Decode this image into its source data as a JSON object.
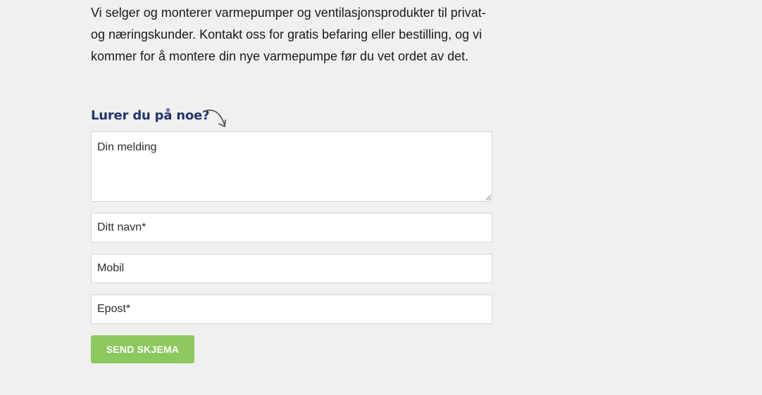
{
  "intro": {
    "text": "Vi selger og monterer varmepumper og ventilasjonsprodukter til privat- og næringskunder. Kontakt oss for gratis befaring eller bestilling, og vi kommer for å montere din nye varmepumpe før du vet ordet av det."
  },
  "form": {
    "heading": "Lurer du på noe?",
    "heading_icon": "curved-arrow-down-right-icon",
    "message_placeholder": "Din melding",
    "name_placeholder": "Ditt navn*",
    "mobile_placeholder": "Mobil",
    "email_placeholder": "Epost*",
    "submit_label": "SEND SKJEMA"
  },
  "colors": {
    "background": "#f0f0f0",
    "heading": "#25336b",
    "button": "#8cc85f",
    "button_text": "#ffffff",
    "field_border": "#d6d6d6"
  }
}
